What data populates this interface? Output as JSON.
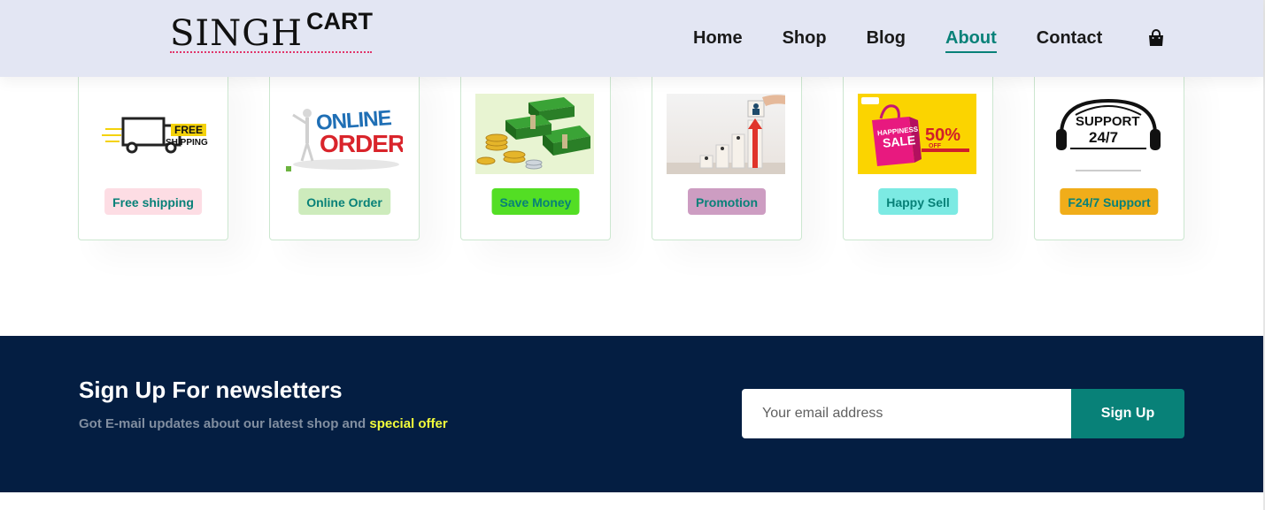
{
  "brand": {
    "main": "SINGH",
    "sup": "CART"
  },
  "nav": {
    "items": [
      {
        "label": "Home"
      },
      {
        "label": "Shop"
      },
      {
        "label": "Blog"
      },
      {
        "label": "About",
        "active": true
      },
      {
        "label": "Contact"
      }
    ],
    "cart_icon": "shopping-bag-icon"
  },
  "features": [
    {
      "label": "Free shipping",
      "image": "free-shipping-truck",
      "bg": "#fddde4",
      "image_text": [
        "FREE",
        "SHIPPING"
      ]
    },
    {
      "label": "Online Order",
      "image": "online-order",
      "bg": "#cdebbc",
      "image_text": [
        "ONLINE",
        "ORDER"
      ]
    },
    {
      "label": "Save Money",
      "image": "money-stacks",
      "bg": "#53de24"
    },
    {
      "label": "Promotion",
      "image": "promotion-growth",
      "bg": "#cd9dc2"
    },
    {
      "label": "Happy Sell",
      "image": "happiness-sale",
      "bg": "#7ceae3",
      "image_text": [
        "HAPPINESS",
        "SALE",
        "50%",
        "OFF"
      ]
    },
    {
      "label": "F24/7 Support",
      "image": "support-headset",
      "bg": "#f0ad1a",
      "image_text": [
        "SUPPORT",
        "24/7"
      ]
    }
  ],
  "newsletter": {
    "title": "Sign Up For newsletters",
    "text": "Got E-mail updates about our latest shop and ",
    "highlight": "special offer",
    "placeholder": "Your email address",
    "button": "Sign Up"
  },
  "colors": {
    "header_bg": "#e3e6f3",
    "accent": "#088178",
    "newsletter_bg": "#041e42",
    "highlight": "#f2fc3b"
  }
}
